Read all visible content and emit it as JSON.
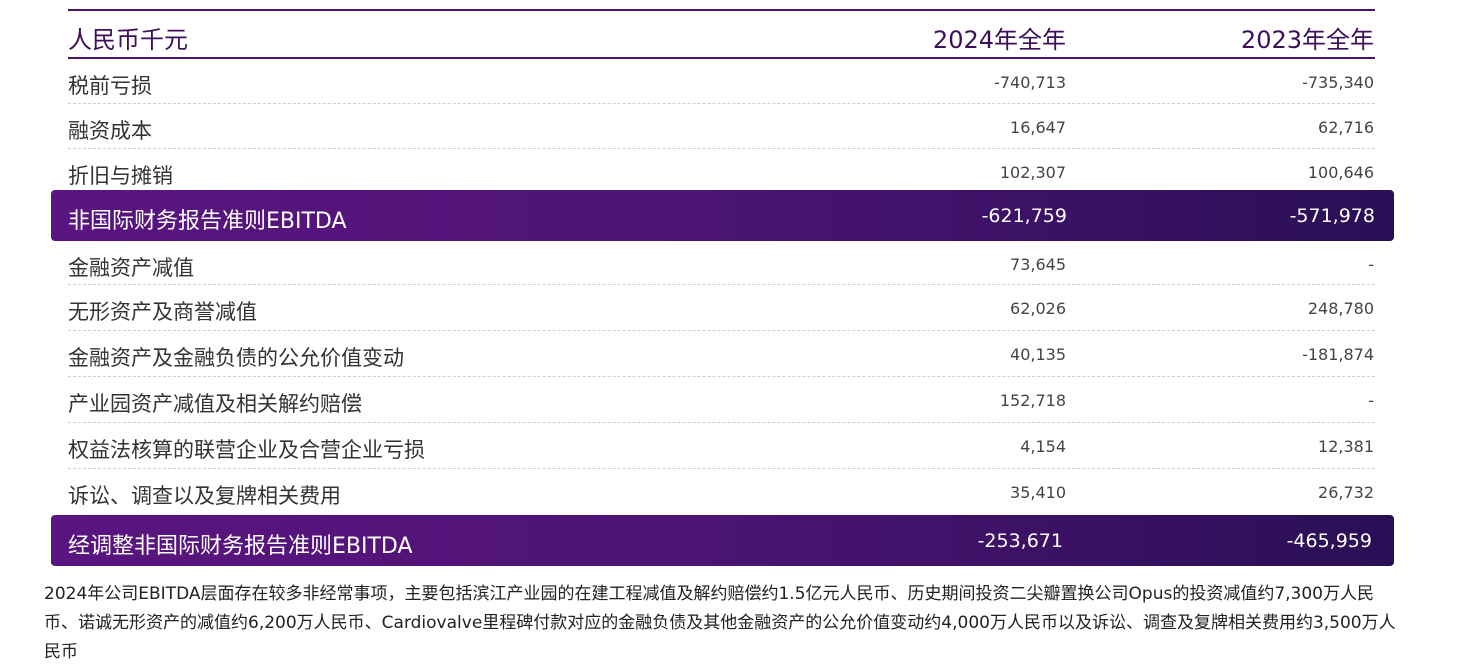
{
  "table": {
    "header": {
      "label": "人民币千元",
      "col_2024": "2024年全年",
      "col_2023": "2023年全年"
    },
    "rows_a": [
      {
        "label": "税前亏损",
        "v2024": "-740,713",
        "v2023": "-735,340"
      },
      {
        "label": "融资成本",
        "v2024": "16,647",
        "v2023": "62,716"
      },
      {
        "label": "折旧与摊销",
        "v2024": "102,307",
        "v2023": "100,646"
      }
    ],
    "highlight_1": {
      "label": "非国际财务报告准则EBITDA",
      "v2024": "-621,759",
      "v2023": "-571,978"
    },
    "rows_b": [
      {
        "label": "金融资产减值",
        "v2024": "73,645",
        "v2023": "-"
      },
      {
        "label": "无形资产及商誉减值",
        "v2024": "62,026",
        "v2023": "248,780"
      },
      {
        "label": "金融资产及金融负债的公允价值变动",
        "v2024": "40,135",
        "v2023": "-181,874"
      },
      {
        "label": "产业园资产减值及相关解约赔偿",
        "v2024": "152,718",
        "v2023": "-"
      },
      {
        "label": "权益法核算的联营企业及合营企业亏损",
        "v2024": "4,154",
        "v2023": "12,381"
      },
      {
        "label": "诉讼、调查以及复牌相关费用",
        "v2024": "35,410",
        "v2023": "26,732"
      }
    ],
    "highlight_2": {
      "label": "经调整非国际财务报告准则EBITDA",
      "v2024": "-253,671",
      "v2023": "-465,959"
    }
  },
  "footnote": "2024年公司EBITDA层面存在较多非经常事项，主要包括滨江产业园的在建工程减值及解约赔偿约1.5亿元人民币、历史期间投资二尖瓣置换公司Opus的投资减值约7,300万人民币、诺诚无形资产的减值约6,200万人民币、Cardiovalve里程碑付款对应的金融负债及其他金融资产的公允价值变动约4,000万人民币以及诉讼、调查及复牌相关费用约3,500万人民币",
  "colors": {
    "accent": "#4a1366",
    "highlight_start": "#5a1580",
    "highlight_end": "#2a0f55",
    "row_divider": "#d9c6e4"
  }
}
